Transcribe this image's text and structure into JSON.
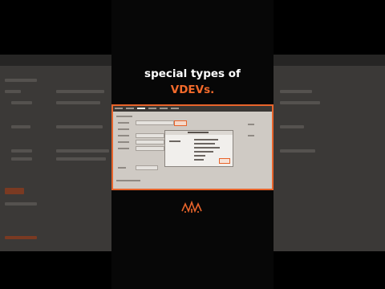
{
  "caption": {
    "line1": "special types of",
    "line2": "VDEVs.",
    "line1_color": "#ffffff",
    "line2_color": "#f26a2b"
  },
  "colors": {
    "accent": "#e8642b",
    "background": "#000000"
  },
  "icons": {
    "logo": "brand-logo-icon"
  }
}
